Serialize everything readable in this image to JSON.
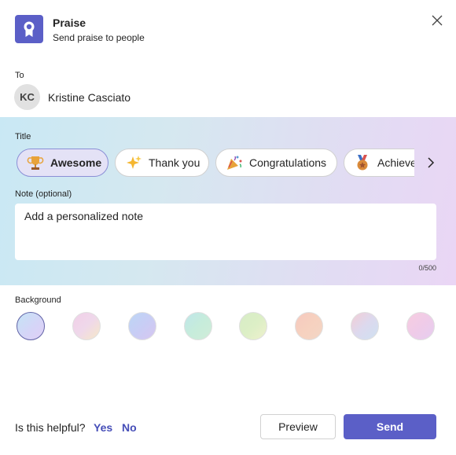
{
  "header": {
    "title": "Praise",
    "subtitle": "Send praise to people",
    "app_icon": "award-ribbon-icon",
    "close_icon": "close-icon"
  },
  "to": {
    "label": "To",
    "avatar_initials": "KC",
    "recipient_name": "Kristine Casciato"
  },
  "title_section": {
    "label": "Title",
    "chips": [
      {
        "label": "Awesome",
        "icon": "trophy-icon",
        "selected": true
      },
      {
        "label": "Thank you",
        "icon": "sparkles-icon",
        "selected": false
      },
      {
        "label": "Congratulations",
        "icon": "party-popper-icon",
        "selected": false
      },
      {
        "label": "Achievement",
        "icon": "medal-icon",
        "selected": false
      }
    ],
    "next_icon": "chevron-right-icon"
  },
  "note": {
    "label": "Note (optional)",
    "placeholder": "Add a personalized note",
    "counter": "0/500"
  },
  "background": {
    "label": "Background",
    "swatches": [
      {
        "name": "blue-lavender",
        "selected": true
      },
      {
        "name": "pink-peach",
        "selected": false
      },
      {
        "name": "periwinkle",
        "selected": false
      },
      {
        "name": "mint",
        "selected": false
      },
      {
        "name": "lime",
        "selected": false
      },
      {
        "name": "coral",
        "selected": false
      },
      {
        "name": "rose-blue",
        "selected": false
      },
      {
        "name": "rose-pink",
        "selected": false
      }
    ]
  },
  "footer": {
    "helpful_text": "Is this helpful?",
    "yes_label": "Yes",
    "no_label": "No",
    "preview_label": "Preview",
    "send_label": "Send"
  },
  "colors": {
    "brand": "#5b5fc7",
    "link": "#464eb8"
  }
}
